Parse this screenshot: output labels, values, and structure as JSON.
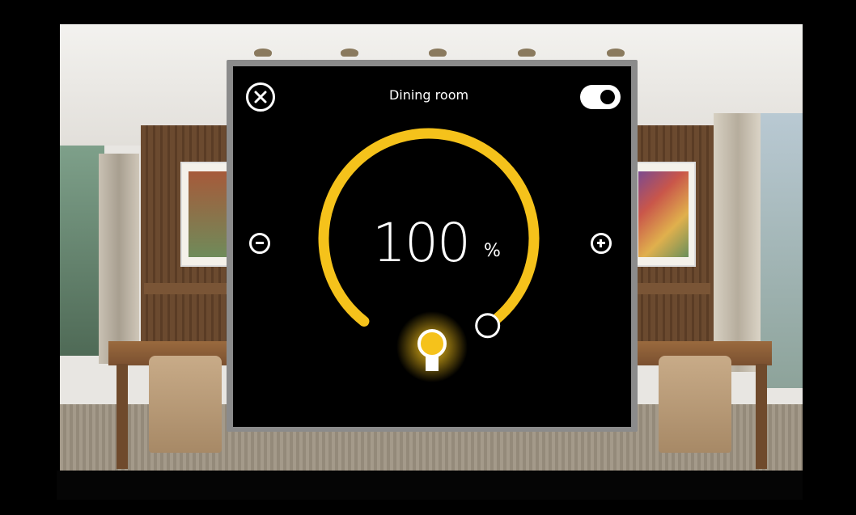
{
  "dialog": {
    "title": "Dining room",
    "power_on": true
  },
  "dimmer": {
    "value": "100",
    "unit": "%",
    "level_percent": 100
  },
  "colors": {
    "accent": "#F5C21B",
    "background": "#000000",
    "foreground": "#FFFFFF"
  },
  "icons": {
    "close": "close-icon",
    "minus": "minus-icon",
    "plus": "plus-icon",
    "toggle": "toggle-switch",
    "light": "lightbulb-icon"
  }
}
